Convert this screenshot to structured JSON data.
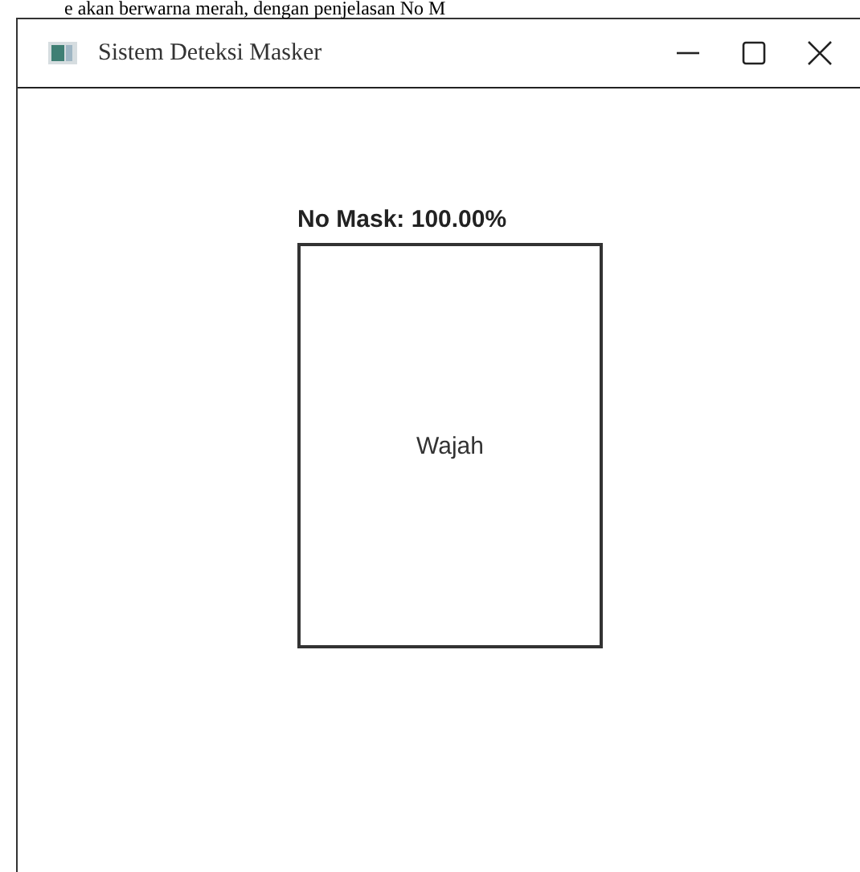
{
  "document_text": "e akan  berwarna merah, dengan penjelasan No M",
  "window": {
    "title": "Sistem Deteksi Masker"
  },
  "detection": {
    "label": "No Mask: 100.00%",
    "box_text": "Wajah"
  }
}
